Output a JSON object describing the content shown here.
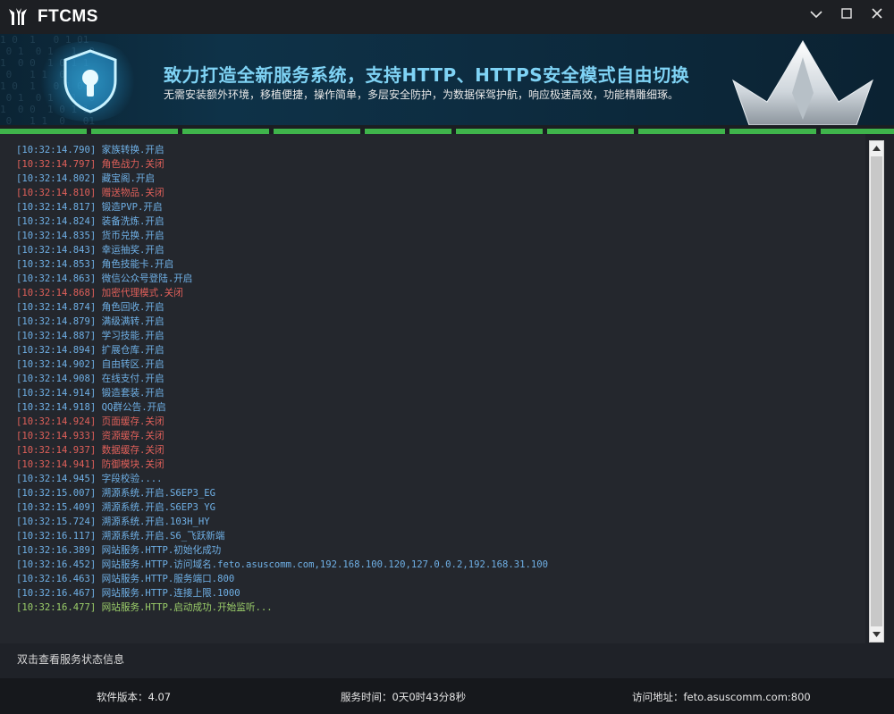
{
  "app": {
    "title": "FTCMS",
    "window_buttons": {
      "minimize_glyph": "⌄",
      "restore_glyph": "□",
      "close_glyph": "✕"
    }
  },
  "banner": {
    "headline": "致力打造全新服务系统，支持HTTP、HTTPS安全模式自由切换",
    "subline": "无需安装额外环境，移植便捷，操作简单，多层安全防护，为数据保驾护航，响应极速高效，功能精雕细琢。"
  },
  "colors": {
    "info": "#6fb0e6",
    "off": "#e0605a",
    "success": "#9ccf6a",
    "progress": "#3fb44b"
  },
  "log": [
    {
      "text": "[10:32:14.790] 家族转换.开启",
      "status": "info"
    },
    {
      "text": "[10:32:14.797] 角色战力.关闭",
      "status": "off"
    },
    {
      "text": "[10:32:14.802] 藏宝阁.开启",
      "status": "info"
    },
    {
      "text": "[10:32:14.810] 赠送物品.关闭",
      "status": "off"
    },
    {
      "text": "[10:32:14.817] 锻造PVP.开启",
      "status": "info"
    },
    {
      "text": "[10:32:14.824] 装备洗炼.开启",
      "status": "info"
    },
    {
      "text": "[10:32:14.835] 货币兑换.开启",
      "status": "info"
    },
    {
      "text": "[10:32:14.843] 幸运抽奖.开启",
      "status": "info"
    },
    {
      "text": "[10:32:14.853] 角色技能卡.开启",
      "status": "info"
    },
    {
      "text": "[10:32:14.863] 微信公众号登陆.开启",
      "status": "info"
    },
    {
      "text": "[10:32:14.868] 加密代理模式.关闭",
      "status": "off"
    },
    {
      "text": "[10:32:14.874] 角色回收.开启",
      "status": "info"
    },
    {
      "text": "[10:32:14.879] 满级满转.开启",
      "status": "info"
    },
    {
      "text": "[10:32:14.887] 学习技能.开启",
      "status": "info"
    },
    {
      "text": "[10:32:14.894] 扩展仓库.开启",
      "status": "info"
    },
    {
      "text": "[10:32:14.902] 自由转区.开启",
      "status": "info"
    },
    {
      "text": "[10:32:14.908] 在线支付.开启",
      "status": "info"
    },
    {
      "text": "[10:32:14.914] 锻造套装.开启",
      "status": "info"
    },
    {
      "text": "[10:32:14.918] QQ群公告.开启",
      "status": "info"
    },
    {
      "text": "[10:32:14.924] 页面缓存.关闭",
      "status": "off"
    },
    {
      "text": "[10:32:14.933] 资源缓存.关闭",
      "status": "off"
    },
    {
      "text": "[10:32:14.937] 数据缓存.关闭",
      "status": "off"
    },
    {
      "text": "[10:32:14.941] 防御模块.关闭",
      "status": "off"
    },
    {
      "text": "[10:32:14.945] 字段校验....",
      "status": "info"
    },
    {
      "text": "[10:32:15.007] 溯源系统.开启.S6EP3_EG",
      "status": "info"
    },
    {
      "text": "[10:32:15.409] 溯源系统.开启.S6EP3 YG",
      "status": "info"
    },
    {
      "text": "[10:32:15.724] 溯源系统.开启.103H_HY",
      "status": "info"
    },
    {
      "text": "[10:32:16.117] 溯源系统.开启.S6_飞跃新端",
      "status": "info"
    },
    {
      "text": "[10:32:16.389] 网站服务.HTTP.初始化成功",
      "status": "info"
    },
    {
      "text": "[10:32:16.452] 网站服务.HTTP.访问域名.feto.asuscomm.com,192.168.100.120,127.0.0.2,192.168.31.100",
      "status": "info"
    },
    {
      "text": "[10:32:16.463] 网站服务.HTTP.服务端口.800",
      "status": "info"
    },
    {
      "text": "[10:32:16.467] 网站服务.HTTP.连接上限.1000",
      "status": "info"
    },
    {
      "text": "[10:32:16.477] 网站服务.HTTP.启动成功.开始监听...",
      "status": "success"
    }
  ],
  "hint": "双击查看服务状态信息",
  "status": {
    "version": "软件版本：4.07",
    "uptime": "服务时间：0天0时43分8秒",
    "address": "访问地址：feto.asuscomm.com:800"
  }
}
